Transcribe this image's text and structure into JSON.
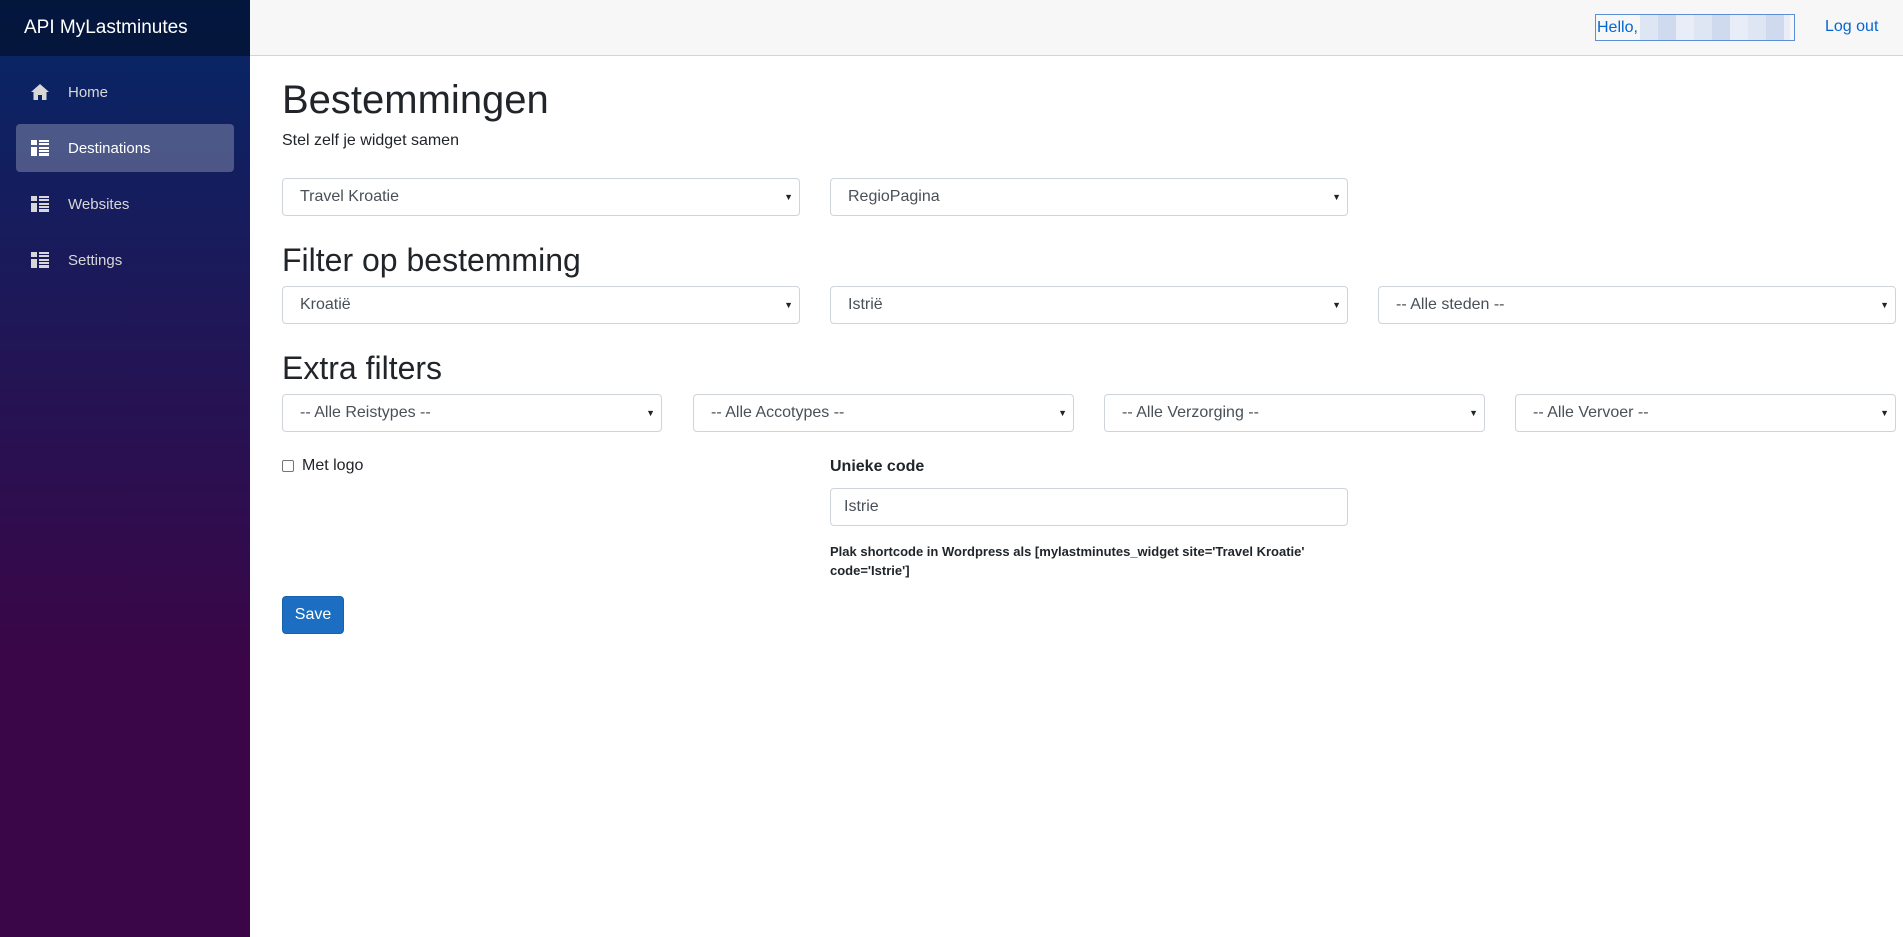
{
  "sidebar": {
    "brand": "API MyLastminutes",
    "items": [
      {
        "label": "Home",
        "icon": "home-icon"
      },
      {
        "label": "Destinations",
        "icon": "list-grid-icon",
        "active": true
      },
      {
        "label": "Websites",
        "icon": "list-grid-icon"
      },
      {
        "label": "Settings",
        "icon": "list-grid-icon"
      }
    ]
  },
  "topbar": {
    "hello": "Hello,",
    "logout": "Log out"
  },
  "main": {
    "title": "Bestemmingen",
    "subtitle": "Stel zelf je widget samen",
    "site_select": "Travel Kroatie",
    "page_type_select": "RegioPagina",
    "filter_heading": "Filter op bestemming",
    "country_select": "Kroatië",
    "region_select": "Istrië",
    "city_select": "-- Alle steden --",
    "extra_heading": "Extra filters",
    "travel_type_select": "-- Alle Reistypes --",
    "acco_type_select": "-- Alle Accotypes --",
    "board_select": "-- Alle Verzorging --",
    "transport_select": "-- Alle Vervoer --",
    "logo_checkbox_label": "Met logo",
    "unique_code_label": "Unieke code",
    "unique_code_value": "Istrie",
    "shortcode_hint": "Plak shortcode in Wordpress als [mylastminutes_widget site='Travel Kroatie' code='Istrie']",
    "save_label": "Save"
  },
  "colors": {
    "sidebar_top": "#052767",
    "sidebar_bottom": "#3a0647",
    "link": "#0366d6",
    "primary_button": "#1b6ec2"
  }
}
